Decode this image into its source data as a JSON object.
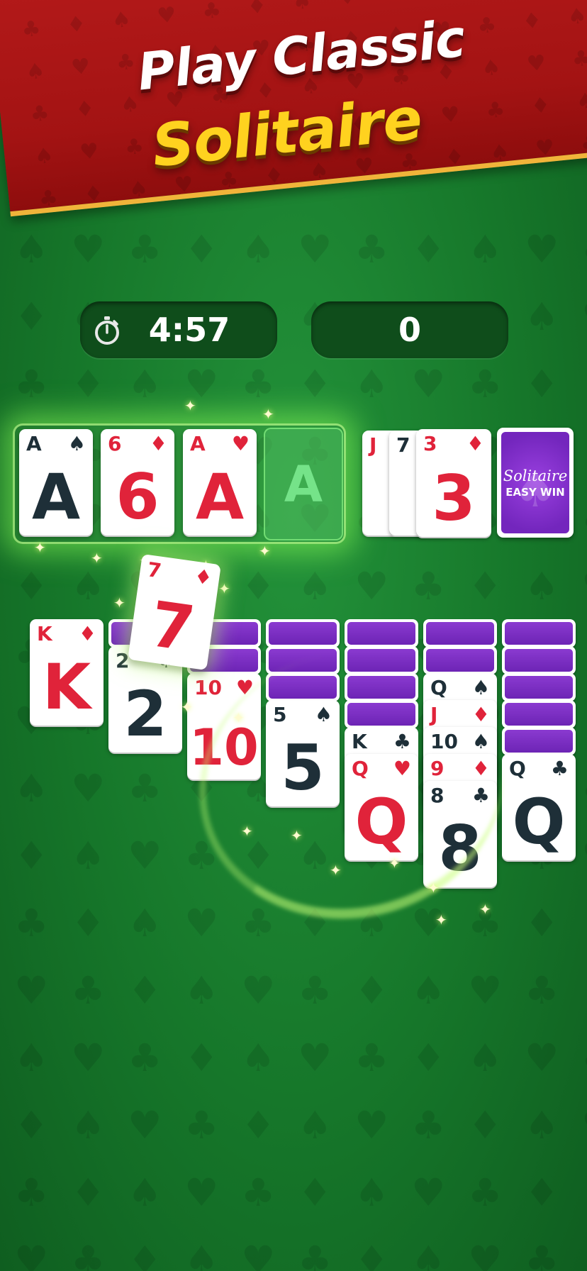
{
  "banner": {
    "line1": "Play Classic",
    "line2": "Solitaire"
  },
  "hud": {
    "timer": "4:57",
    "score": "0",
    "timer_icon": "stopwatch-icon"
  },
  "foundation": [
    {
      "rank": "A",
      "suit": "♠",
      "color": "black"
    },
    {
      "rank": "6",
      "suit": "♦",
      "color": "red"
    },
    {
      "rank": "A",
      "suit": "♥",
      "color": "red"
    },
    {
      "rank": "A",
      "empty": true
    }
  ],
  "waste": [
    {
      "rank": "J",
      "color": "red"
    },
    {
      "rank": "7",
      "color": "black"
    },
    {
      "rank": "3",
      "suit": "♦",
      "color": "red"
    }
  ],
  "stock": {
    "brand_line1": "Solitaire",
    "brand_line2": "EASY WIN"
  },
  "moving_card": {
    "rank": "7",
    "suit": "♦",
    "color": "red"
  },
  "tableau": [
    {
      "face_down": 0,
      "cards": [
        {
          "rank": "K",
          "suit": "♦",
          "color": "red"
        }
      ]
    },
    {
      "face_down": 1,
      "cards": [
        {
          "rank": "2",
          "suit": "♠",
          "color": "black"
        }
      ]
    },
    {
      "face_down": 2,
      "cards": [
        {
          "rank": "10",
          "suit": "♥",
          "color": "red"
        }
      ]
    },
    {
      "face_down": 3,
      "cards": [
        {
          "rank": "5",
          "suit": "♠",
          "color": "black"
        }
      ]
    },
    {
      "face_down": 4,
      "cards": [
        {
          "rank": "K",
          "suit": "♣",
          "color": "black"
        },
        {
          "rank": "Q",
          "suit": "♥",
          "color": "red"
        }
      ]
    },
    {
      "face_down": 2,
      "cards": [
        {
          "rank": "Q",
          "suit": "♠",
          "color": "black"
        },
        {
          "rank": "J",
          "suit": "♦",
          "color": "red"
        },
        {
          "rank": "10",
          "suit": "♠",
          "color": "black"
        },
        {
          "rank": "9",
          "suit": "♦",
          "color": "red"
        },
        {
          "rank": "8",
          "suit": "♣",
          "color": "black"
        }
      ]
    },
    {
      "face_down": 5,
      "cards": [
        {
          "rank": "Q",
          "suit": "♣",
          "color": "black"
        }
      ]
    }
  ]
}
